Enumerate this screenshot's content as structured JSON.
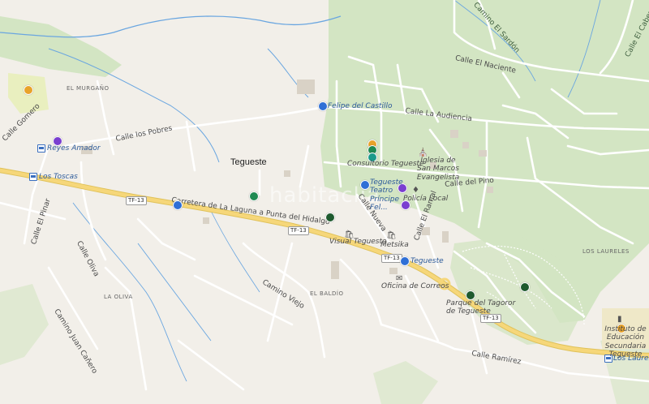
{
  "watermark": "habitaclia",
  "town": "Tegueste",
  "roads": {
    "carretera": "Carretera de La Laguna a Punta del Hidalgo",
    "calle_la_audiencia": "Calle La Audiencia",
    "calle_el_naciente": "Calle El Naciente",
    "camino_el_sardon": "Camino El Sardón",
    "calle_el_cabezo": "Calle El Cabezo",
    "calle_los_pobres": "Calle los Pobres",
    "calle_del_pino": "Calle del Pino",
    "calle_nueva": "Calle Nueva",
    "calle_el_ramal": "Calle El Ramal",
    "calle_el_pinar": "Calle El Pinar",
    "calle_oliva": "Calle Oliva",
    "camino_juan_canero": "Camino Juan Cañero",
    "camino_viejo": "Camino Viejo",
    "calle_ramirez": "Calle Ramírez",
    "calle_gomero": "Calle Gomero"
  },
  "shields": {
    "tf13_a": "TF-13",
    "tf13_b": "TF-13",
    "tf13_c": "TF-13",
    "tf13_d": "TF-13"
  },
  "areas": {
    "el_murgano": "EL MURGAÑO",
    "la_oliva": "LA OLIVA",
    "el_baldio": "EL BALDÍO",
    "los_laureles": "LOS LAURELES"
  },
  "places": {
    "felipe_del_castillo": "Felipe del Castillo",
    "consultorio": "Consultorio Tegueste",
    "iglesia": "Iglesia de San Marcos Evangelista",
    "teatro": "Tegueste Teatro Príncipe Fel...",
    "policia": "Policía Local",
    "reyes_amador": "Reyes Amador",
    "los_toscas": "Los Toscas",
    "visual_tegueste": "Visual Tegueste",
    "metsika": "Metsika",
    "tegueste_stop": "Tegueste",
    "oficina_correos": "Oficina de Correos",
    "parque_tagoror": "Parque del Tagoror de Tegueste",
    "instituto": "Instituto de Educación Secundaria Tegueste",
    "los_laureles_stop": "Los Laureles"
  },
  "colors": {
    "land": "#f2efe9",
    "park": "#d3e5c3",
    "water": "#6aa6e0",
    "highway": "#f6d77a",
    "poi_blue": "#2f6fd6",
    "poi_purple": "#7a3fd0",
    "poi_green": "#1f8a52",
    "poi_darkgreen": "#1e5a2e",
    "poi_orange": "#e8a32a",
    "poi_teal": "#1a9a8a"
  }
}
